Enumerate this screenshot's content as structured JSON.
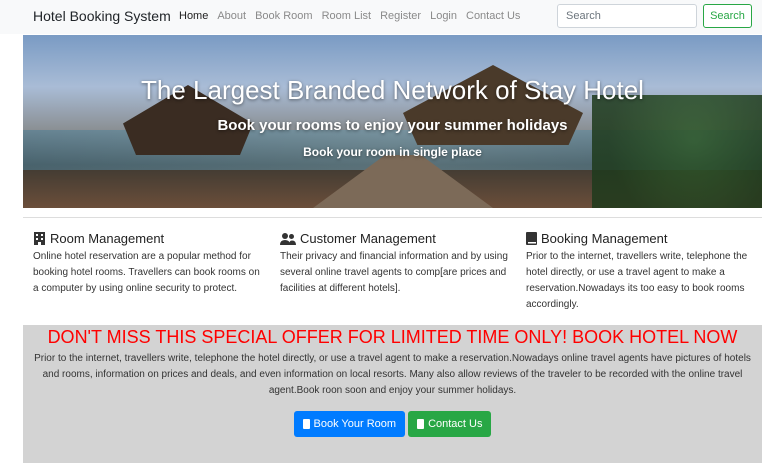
{
  "nav": {
    "brand": "Hotel Booking System",
    "links": [
      "Home",
      "About",
      "Book Room",
      "Room List",
      "Register",
      "Login",
      "Contact Us"
    ],
    "search_placeholder": "Search",
    "search_button": "Search"
  },
  "hero": {
    "title": "The Largest Branded Network of Stay Hotel",
    "subtitle": "Book your rooms to enjoy your summer holidays",
    "tagline": "Book your room in single place"
  },
  "features": [
    {
      "icon": "building-icon",
      "title": "Room Management",
      "text": "Online hotel reservation are a popular method for booking hotel rooms. Travellers can book rooms on a computer by using online security to protect."
    },
    {
      "icon": "users-icon",
      "title": "Customer Management",
      "text": "Their privacy and financial information and by using several online travel agents to comp[are prices and facilities at different hotels]."
    },
    {
      "icon": "book-icon",
      "title": "Booking Management",
      "text": "Prior to the internet, travellers write, telephone the hotel directly, or use a travel agent to make a reservation.Nowadays its too easy to book rooms accordingly."
    }
  ],
  "offer": {
    "title": "DON'T MISS THIS SPECIAL OFFER FOR LIMITED TIME ONLY! BOOK HOTEL NOW",
    "text": "Prior to the internet, travellers write, telephone the hotel directly, or use a travel agent to make a reservation.Nowadays online travel agents have pictures of hotels and rooms, information on prices and deals, and even information on local resorts. Many also allow reviews of the traveler to be recorded with the online travel agent.Book roon soon and enjoy your summer holidays.",
    "book_button": "Book Your Room",
    "contact_button": "Contact Us"
  },
  "colors": {
    "primary": "#007bff",
    "success": "#28a745",
    "offer_title": "#ff0000",
    "offer_bg": "#d3d3d3"
  }
}
